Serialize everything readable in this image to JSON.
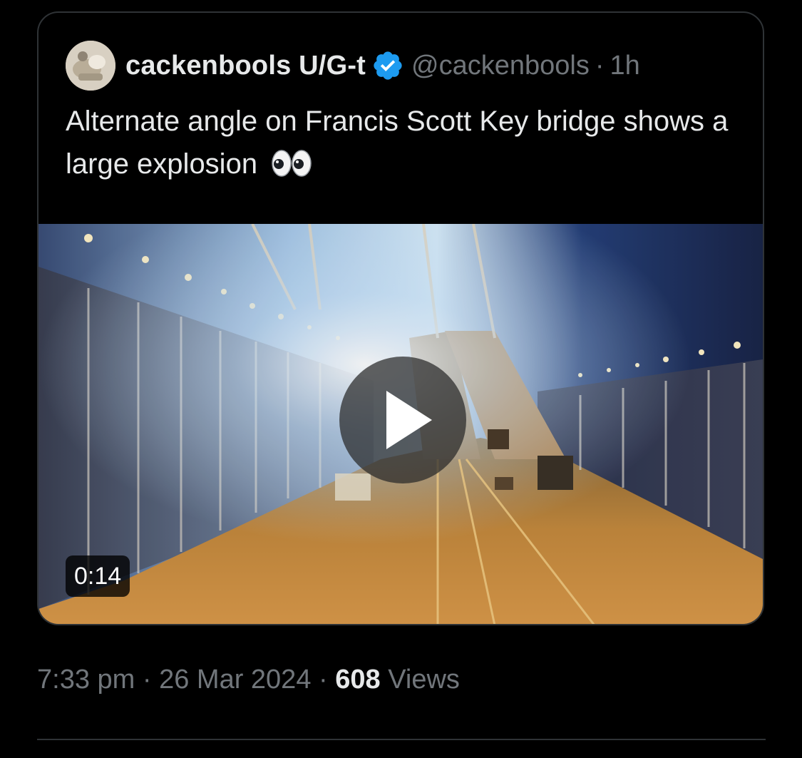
{
  "quoted_post": {
    "author": {
      "display_name": "cackenbools U/G-t",
      "handle": "@cackenbools",
      "verified": true,
      "avatar_icon": "avatar-photo"
    },
    "separator": "·",
    "time_ago": "1h",
    "text": "Alternate angle on Francis Scott Key bridge shows a large explosion",
    "emoji_icon": "eyes-emoji-icon",
    "media": {
      "type": "video",
      "duration": "0:14",
      "play_icon": "play-icon"
    }
  },
  "post_meta": {
    "time": "7:33 pm",
    "date": "26 Mar 2024",
    "separator": "·",
    "views_count": "608",
    "views_label": "Views"
  },
  "colors": {
    "background": "#000000",
    "primary_text": "#e7e9ea",
    "secondary_text": "#71767b",
    "border": "#2f3336",
    "verified_blue": "#1d9bf0"
  }
}
